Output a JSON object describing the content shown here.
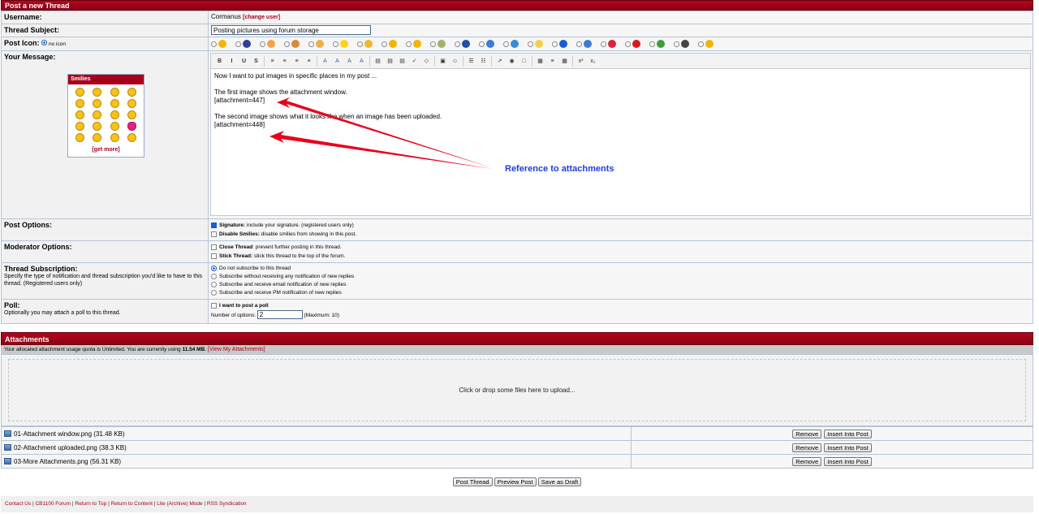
{
  "post": {
    "title": "Post a new Thread",
    "username_label": "Username:",
    "username": "Cormanus",
    "change_user": "[change user]",
    "subject_label": "Thread Subject:",
    "subject_value": "Posting pictures using forum storage",
    "icon_label": "Post Icon:",
    "no_icon": "no icon",
    "icon_colors": [
      "#f4b400",
      "#2e3f9e",
      "#f4a24a",
      "#d88a3a",
      "#e9b24c",
      "#ffd21a",
      "#f0b62d",
      "#f4b400",
      "#f4b400",
      "#9db36a",
      "#1f4fa8",
      "#3c7bd6",
      "#3a8bd0",
      "#f2d04b",
      "#1a5bd6",
      "#3c7bd6",
      "#e0203a",
      "#d61a1a",
      "#3aa03a",
      "#444444",
      "#f4b400"
    ],
    "message_label": "Your Message:",
    "smilies_title": "Smilies",
    "get_more": "[get more]",
    "toolbar": [
      "B",
      "I",
      "U",
      "S",
      "≡",
      "≡",
      "≡",
      "≡",
      "A",
      "A",
      "A",
      "A",
      "▤",
      "▤",
      "▤",
      "✓",
      "◇",
      "▣",
      "☺",
      "☰",
      "☷",
      "↗",
      "◉",
      "□",
      "▦",
      "≡",
      "▦",
      "x²",
      "x₂"
    ],
    "message_lines": [
      "Now I want to put images in specific places in my post ...",
      "",
      "The first image shows the attachment window.",
      "[attachment=447]",
      "",
      "The second image shows what it looks like when an image has been uploaded.",
      "[attachment=448]"
    ],
    "annotation": "Reference to attachments",
    "post_options_label": "Post Options:",
    "signature_bold": "Signature:",
    "signature_text": "include your signature. (registered users only)",
    "disable_smilies_bold": "Disable Smilies:",
    "disable_smilies_text": "disable smilies from showing in this post.",
    "mod_options_label": "Moderator Options:",
    "close_thread_bold": "Close Thread",
    "close_thread_text": ": prevent further posting in this thread.",
    "stick_thread_bold": "Stick Thread:",
    "stick_thread_text": "stick this thread to the top of the forum.",
    "subscription_label": "Thread Subscription:",
    "subscription_desc": "Specify the type of notification and thread subscription you'd like to have to this thread. (Registered users only)",
    "subscription_options": [
      "Do not subscribe to this thread",
      "Subscribe without receiving any notification of new replies",
      "Subscribe and receive email notification of new replies",
      "Subscribe and receive PM notification of new replies"
    ],
    "poll_label": "Poll:",
    "poll_desc": "Optionally you may attach a poll to this thread.",
    "poll_check": "I want to post a poll",
    "poll_num_label": "Number of options:",
    "poll_num_value": "2",
    "poll_max": "(Maximum: 10)"
  },
  "attachments": {
    "title": "Attachments",
    "quota_prefix": "Your allocated attachment usage quota is Unlimited. You are currently using ",
    "quota_used": "11.54 MB",
    "quota_suffix": ". ",
    "view_link": "[View My Attachments]",
    "drop_text": "Click or drop some files here to upload...",
    "files": [
      {
        "name": "01-Attachment window.png (31.48 KB)"
      },
      {
        "name": "02-Attachment uploaded.png (38.3 KB)"
      },
      {
        "name": "03-More Attachments.png (56.31 KB)"
      }
    ],
    "remove_label": "Remove",
    "insert_label": "Insert Into Post"
  },
  "actions": {
    "post_thread": "Post Thread",
    "preview_post": "Preview Post",
    "save_draft": "Save as Draft"
  },
  "footer": {
    "links": [
      "Contact Us",
      "CB1100 Forum",
      "Return to Top",
      "Return to Content",
      "Lite (Archive) Mode",
      "RSS Syndication"
    ]
  }
}
